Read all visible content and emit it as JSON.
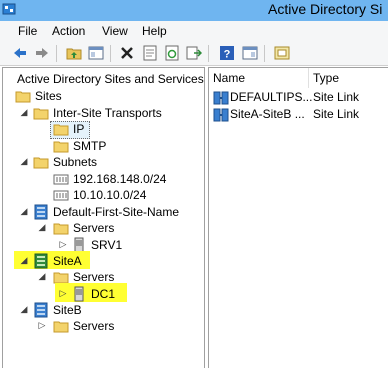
{
  "window": {
    "title": "Active Directory Si"
  },
  "menu": {
    "file": "File",
    "action": "Action",
    "view": "View",
    "help": "Help"
  },
  "toolbar": {
    "icons": [
      "back-arrow-icon",
      "forward-arrow-icon",
      "up-folder-icon",
      "show-tree-icon",
      "delete-icon",
      "properties-icon",
      "refresh-icon",
      "export-list-icon",
      "help-icon",
      "console-icon",
      "new-window-icon"
    ]
  },
  "tree": {
    "root": "Active Directory Sites and Services [",
    "sites": "Sites",
    "inter_site_transports": "Inter-Site Transports",
    "ip": "IP",
    "smtp": "SMTP",
    "subnets": "Subnets",
    "subnet1": "192.168.148.0/24",
    "subnet2": "10.10.10.0/24",
    "default_site": "Default-First-Site-Name",
    "servers1": "Servers",
    "srv1": "SRV1",
    "sitea": "SiteA",
    "servers2": "Servers",
    "dc1": "DC1",
    "siteb": "SiteB",
    "servers3": "Servers"
  },
  "list": {
    "columns": [
      "Name",
      "Type"
    ],
    "rows": [
      {
        "name": "DEFAULTIPS...",
        "type": "Site Link"
      },
      {
        "name": "SiteA-SiteB ...",
        "type": "Site Link"
      }
    ]
  },
  "colors": {
    "highlight": "#ffff33",
    "titlebar": "#6fb5f0"
  }
}
